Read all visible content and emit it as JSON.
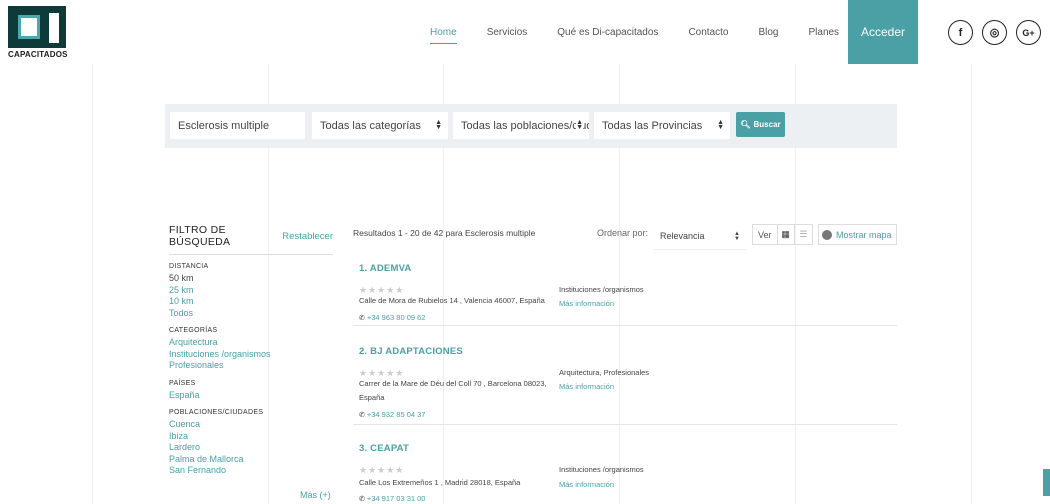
{
  "logo": {
    "text": "CAPACITADOS"
  },
  "nav": {
    "items": [
      "Home",
      "Servicios",
      "Qué es Di-capacitados",
      "Contacto",
      "Blog",
      "Planes"
    ],
    "acceder": "Acceder"
  },
  "social": {
    "facebook": "f",
    "instagram": "◎",
    "googleplus": "G+"
  },
  "search": {
    "query": "Esclerosis multiple",
    "category": "Todas las categorías",
    "city": "Todas las poblaciones/ciudades",
    "province": "Todas las Provincias",
    "button": "Buscar"
  },
  "filter": {
    "title": "FILTRO DE BÚSQUEDA",
    "reset": "Restablecer",
    "distance": {
      "title": "DISTANCIA",
      "options": [
        "50 km",
        "25 km",
        "10 km",
        "Todos"
      ]
    },
    "categories": {
      "title": "CATEGORÍAS",
      "options": [
        "Arquitectura",
        "Instituciones /organismos",
        "Profesionales"
      ]
    },
    "countries": {
      "title": "PAÍSES",
      "options": [
        "España"
      ]
    },
    "cities": {
      "title": "POBLACIONES/CIUDADES",
      "options": [
        "Cuenca",
        "Ibiza",
        "Lardero",
        "Palma de Mallorca",
        "San Fernando"
      ]
    },
    "more": "Más (+)"
  },
  "results": {
    "info": "Resultados 1 - 20 de 42 para Esclerosis multiple",
    "sort_label": "Ordenar por:",
    "sort_value": "Relevancia",
    "view_label": "Ver",
    "map_button": "Mostrar mapa",
    "items": [
      {
        "name": "1. ADEMVA",
        "stars": "★★★★★",
        "address": "Calle de Mora de Rubielos 14 , Valencia 46007, España",
        "phone": "+34 963 80 09 62",
        "category": "Instituciones /organismos",
        "more": "Más información"
      },
      {
        "name": "2. BJ ADAPTACIONES",
        "stars": "★★★★★",
        "address": "Carrer de la Mare de Déu del Coll 70 , Barcelona 08023, España",
        "phone": "+34 932 85 04 37",
        "category": "Arquitectura,  Profesionales",
        "more": "Más información"
      },
      {
        "name": "3. CEAPAT",
        "stars": "★★★★★",
        "address": "Calle Los Extremeños 1 , Madrid 28018, España",
        "phone": "+34 917 03 31 00",
        "category": "Instituciones /organismos",
        "more": "Más información"
      }
    ]
  },
  "colors": {
    "accent": "#4aa0a5",
    "logo_dark": "#0f3a3a",
    "searchbar_bg": "#edf0f2"
  }
}
